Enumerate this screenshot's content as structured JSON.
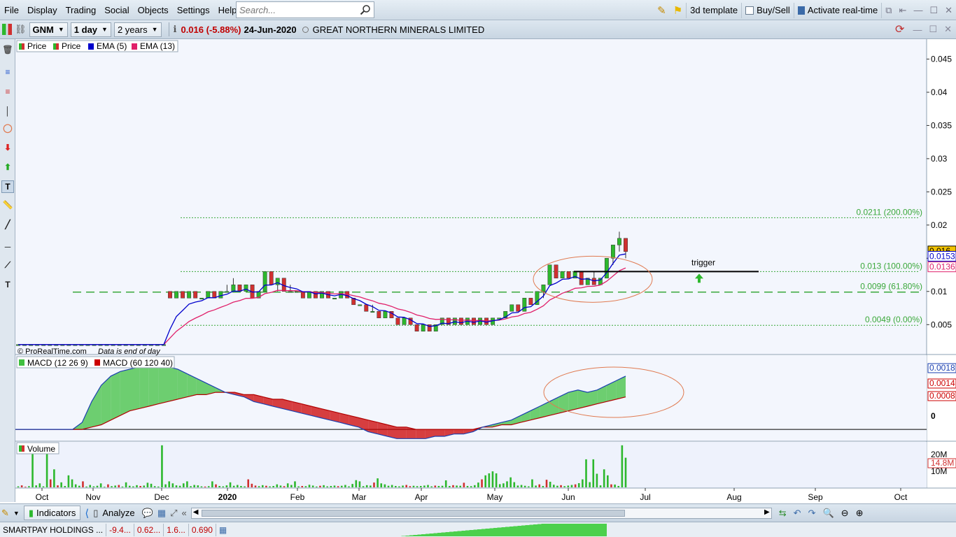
{
  "menu": {
    "items": [
      "File",
      "Display",
      "Trading",
      "Social",
      "Objects",
      "Settings",
      "Help"
    ],
    "search_placeholder": "Search...",
    "template_label": "3d template",
    "buysell_label": "Buy/Sell",
    "realtime_label": "Activate real-time"
  },
  "toolbar": {
    "ticker": "GNM",
    "interval": "1 day",
    "range": "2 years",
    "price_change": "0.016 (-5.88%)",
    "date": "24-Jun-2020",
    "company": "GREAT NORTHERN MINERALS LIMITED"
  },
  "bottom": {
    "indicators_label": "Indicators",
    "analyze_label": "Analyze"
  },
  "status": {
    "ticker": "SMARTPAY HOLDINGS ...",
    "cells": [
      "-9.4...",
      "0.62...",
      "1.6...",
      "0.690"
    ]
  },
  "colors": {
    "ema5": "#0000cc",
    "ema13": "#e0206a",
    "up": "#2db82d",
    "down": "#d03030",
    "fib": "#3aa83a",
    "macd_fill_pos": "#40c040",
    "macd_fill_neg": "#cc0000",
    "ellipse": "#e07a50"
  },
  "chart_data": [
    {
      "type": "candlestick",
      "legend": [
        "Price",
        "Price",
        "EMA (5)",
        "EMA (13)"
      ],
      "watermark": "© ProRealTime.com",
      "watermark_note": "Data is end of day",
      "x_ticks": [
        "Oct",
        "Nov",
        "Dec",
        "2020",
        "Feb",
        "Mar",
        "Apr",
        "May",
        "Jun",
        "Jul",
        "Aug",
        "Sep",
        "Oct"
      ],
      "y_ticks": [
        0.005,
        0.01,
        0.015,
        0.02,
        0.025,
        0.03,
        0.035,
        0.04,
        0.045
      ],
      "ylim": [
        0.0005,
        0.048
      ],
      "last_price": "0.016",
      "ema5_last": "0.0153",
      "ema13_last": "0.0136",
      "fib_levels": [
        {
          "value": 0.0211,
          "label": "0.0211 (200.00%)",
          "style": "dotted"
        },
        {
          "value": 0.013,
          "label": "0.013 (100.00%)",
          "style": "dotted"
        },
        {
          "value": 0.0099,
          "label": "0.0099 (61.80%)",
          "style": "dashed"
        },
        {
          "value": 0.0049,
          "label": "0.0049 (0.00%)",
          "style": "dotted"
        }
      ],
      "annotation": {
        "text": "trigger"
      },
      "ohlc": [
        [
          0.002,
          0.002,
          0.002,
          0.002
        ],
        [
          0.002,
          0.002,
          0.002,
          0.002
        ],
        [
          0.002,
          0.002,
          0.002,
          0.002
        ],
        [
          0.002,
          0.002,
          0.002,
          0.002
        ],
        [
          0.002,
          0.002,
          0.002,
          0.002
        ],
        [
          0.002,
          0.002,
          0.002,
          0.002
        ],
        [
          0.002,
          0.002,
          0.002,
          0.002
        ],
        [
          0.002,
          0.002,
          0.002,
          0.002
        ],
        [
          0.002,
          0.002,
          0.002,
          0.002
        ],
        [
          0.002,
          0.002,
          0.002,
          0.002
        ],
        [
          0.002,
          0.002,
          0.002,
          0.002
        ],
        [
          0.002,
          0.002,
          0.002,
          0.002
        ],
        [
          0.002,
          0.002,
          0.002,
          0.002
        ],
        [
          0.002,
          0.002,
          0.002,
          0.002
        ],
        [
          0.002,
          0.002,
          0.002,
          0.002
        ],
        [
          0.002,
          0.002,
          0.002,
          0.002
        ],
        [
          0.002,
          0.002,
          0.002,
          0.002
        ],
        [
          0.002,
          0.002,
          0.002,
          0.002
        ],
        [
          0.002,
          0.002,
          0.002,
          0.002
        ],
        [
          0.002,
          0.002,
          0.002,
          0.002
        ],
        [
          0.002,
          0.002,
          0.002,
          0.002
        ],
        [
          0.002,
          0.002,
          0.002,
          0.002
        ],
        [
          0.002,
          0.002,
          0.002,
          0.002
        ],
        [
          0.002,
          0.002,
          0.002,
          0.002
        ],
        [
          0.01,
          0.01,
          0.009,
          0.009
        ],
        [
          0.009,
          0.01,
          0.009,
          0.01
        ],
        [
          0.01,
          0.01,
          0.009,
          0.009
        ],
        [
          0.009,
          0.01,
          0.009,
          0.01
        ],
        [
          0.01,
          0.01,
          0.009,
          0.009
        ],
        [
          0.009,
          0.009,
          0.009,
          0.009
        ],
        [
          0.009,
          0.01,
          0.009,
          0.01
        ],
        [
          0.01,
          0.01,
          0.009,
          0.009
        ],
        [
          0.009,
          0.01,
          0.009,
          0.01
        ],
        [
          0.01,
          0.011,
          0.01,
          0.01
        ],
        [
          0.01,
          0.012,
          0.01,
          0.011
        ],
        [
          0.011,
          0.011,
          0.01,
          0.01
        ],
        [
          0.01,
          0.011,
          0.01,
          0.011
        ],
        [
          0.011,
          0.011,
          0.009,
          0.009
        ],
        [
          0.009,
          0.01,
          0.009,
          0.01
        ],
        [
          0.01,
          0.013,
          0.01,
          0.013
        ],
        [
          0.013,
          0.013,
          0.011,
          0.011
        ],
        [
          0.011,
          0.012,
          0.01,
          0.012
        ],
        [
          0.012,
          0.012,
          0.01,
          0.01
        ],
        [
          0.01,
          0.011,
          0.01,
          0.01
        ],
        [
          0.01,
          0.01,
          0.01,
          0.01
        ],
        [
          0.01,
          0.01,
          0.009,
          0.009
        ],
        [
          0.009,
          0.01,
          0.009,
          0.01
        ],
        [
          0.01,
          0.01,
          0.009,
          0.009
        ],
        [
          0.009,
          0.01,
          0.009,
          0.01
        ],
        [
          0.01,
          0.01,
          0.009,
          0.009
        ],
        [
          0.009,
          0.009,
          0.009,
          0.009
        ],
        [
          0.009,
          0.01,
          0.009,
          0.01
        ],
        [
          0.01,
          0.01,
          0.009,
          0.009
        ],
        [
          0.009,
          0.009,
          0.008,
          0.008
        ],
        [
          0.008,
          0.008,
          0.008,
          0.008
        ],
        [
          0.008,
          0.008,
          0.007,
          0.007
        ],
        [
          0.007,
          0.008,
          0.007,
          0.007
        ],
        [
          0.007,
          0.007,
          0.006,
          0.006
        ],
        [
          0.006,
          0.007,
          0.006,
          0.007
        ],
        [
          0.007,
          0.007,
          0.006,
          0.006
        ],
        [
          0.006,
          0.006,
          0.005,
          0.005
        ],
        [
          0.005,
          0.006,
          0.005,
          0.006
        ],
        [
          0.006,
          0.006,
          0.005,
          0.005
        ],
        [
          0.005,
          0.005,
          0.004,
          0.004
        ],
        [
          0.004,
          0.005,
          0.004,
          0.005
        ],
        [
          0.005,
          0.005,
          0.004,
          0.004
        ],
        [
          0.004,
          0.005,
          0.004,
          0.005
        ],
        [
          0.005,
          0.006,
          0.005,
          0.006
        ],
        [
          0.006,
          0.006,
          0.005,
          0.005
        ],
        [
          0.005,
          0.006,
          0.005,
          0.006
        ],
        [
          0.006,
          0.006,
          0.005,
          0.005
        ],
        [
          0.005,
          0.006,
          0.005,
          0.006
        ],
        [
          0.006,
          0.006,
          0.005,
          0.005
        ],
        [
          0.005,
          0.006,
          0.005,
          0.006
        ],
        [
          0.006,
          0.006,
          0.005,
          0.005
        ],
        [
          0.005,
          0.006,
          0.005,
          0.006
        ],
        [
          0.006,
          0.006,
          0.006,
          0.006
        ],
        [
          0.006,
          0.007,
          0.006,
          0.007
        ],
        [
          0.007,
          0.008,
          0.007,
          0.008
        ],
        [
          0.008,
          0.008,
          0.007,
          0.007
        ],
        [
          0.007,
          0.009,
          0.007,
          0.009
        ],
        [
          0.009,
          0.009,
          0.008,
          0.008
        ],
        [
          0.008,
          0.01,
          0.008,
          0.01
        ],
        [
          0.01,
          0.011,
          0.009,
          0.011
        ],
        [
          0.011,
          0.014,
          0.011,
          0.014
        ],
        [
          0.014,
          0.014,
          0.012,
          0.012
        ],
        [
          0.012,
          0.013,
          0.012,
          0.013
        ],
        [
          0.013,
          0.013,
          0.012,
          0.012
        ],
        [
          0.012,
          0.013,
          0.012,
          0.013
        ],
        [
          0.013,
          0.013,
          0.011,
          0.011
        ],
        [
          0.011,
          0.012,
          0.011,
          0.012
        ],
        [
          0.012,
          0.013,
          0.011,
          0.011
        ],
        [
          0.011,
          0.012,
          0.011,
          0.012
        ],
        [
          0.012,
          0.015,
          0.012,
          0.015
        ],
        [
          0.015,
          0.017,
          0.014,
          0.017
        ],
        [
          0.017,
          0.019,
          0.016,
          0.018
        ],
        [
          0.018,
          0.018,
          0.015,
          0.016
        ]
      ]
    },
    {
      "type": "area",
      "legend": [
        "MACD (12 26 9)",
        "MACD (60 120 40)"
      ],
      "axis_labels": [
        "0.0018",
        "0.0014",
        "0.0008",
        "0"
      ],
      "zero_value": 0,
      "macd_fast": [
        0,
        0,
        0,
        0,
        0,
        0,
        0,
        0.0003,
        0.0012,
        0.0019,
        0.0023,
        0.0025,
        0.0026,
        0.0027,
        0.0028,
        0.0028,
        0.0027,
        0.0026,
        0.0024,
        0.0022,
        0.002,
        0.0018,
        0.0016,
        0.0015,
        0.0014,
        0.0012,
        0.0011,
        0.001,
        0.0009,
        0.0008,
        0.0007,
        0.0006,
        0.0005,
        0.0004,
        0.0003,
        0.0002,
        0.0001,
        -0.0001,
        -0.0002,
        -0.0003,
        -0.0004,
        -0.0004,
        -0.0004,
        -0.0004,
        -0.0003,
        -0.0003,
        -0.0002,
        -0.0002,
        -0.0001,
        0.0001,
        0.0002,
        0.0003,
        0.0004,
        0.0006,
        0.0008,
        0.001,
        0.0012,
        0.0014,
        0.0016,
        0.0017,
        0.0016,
        0.0017,
        0.0019,
        0.0021,
        0.0023
      ],
      "macd_slow": [
        0,
        0,
        0,
        0,
        0,
        0,
        0,
        0,
        0.0001,
        0.0002,
        0.0004,
        0.0006,
        0.0008,
        0.0009,
        0.001,
        0.0011,
        0.0012,
        0.0013,
        0.0014,
        0.0015,
        0.0015,
        0.0016,
        0.0016,
        0.0016,
        0.0015,
        0.0015,
        0.0014,
        0.0013,
        0.0013,
        0.0012,
        0.0011,
        0.001,
        0.0009,
        0.0008,
        0.0007,
        0.0006,
        0.0005,
        0.0004,
        0.0003,
        0.0002,
        0.0001,
        0.0001,
        0,
        0,
        0,
        0,
        0,
        0,
        0,
        0.0001,
        0.0001,
        0.0002,
        0.0002,
        0.0003,
        0.0004,
        0.0005,
        0.0006,
        0.0007,
        0.0008,
        0.0009,
        0.001,
        0.0011,
        0.0012,
        0.0013,
        0.0014
      ]
    },
    {
      "type": "bar",
      "legend": [
        "Volume"
      ],
      "axis_labels": [
        "20M",
        "14.8M",
        "10M"
      ],
      "ylim": [
        0,
        22
      ],
      "unit": "M",
      "volumes": [
        0.5,
        1,
        0.3,
        0.6,
        20,
        1,
        2,
        0.5,
        20,
        4,
        9,
        1,
        2.5,
        0.7,
        6,
        4,
        1.5,
        0.8,
        3,
        0.4,
        1.2,
        0.5,
        0.8,
        2,
        0.3,
        1.5,
        0.6,
        0.9,
        1.2,
        0.4,
        2.5,
        0.8,
        0.5,
        1.1,
        0.7,
        0.9,
        2.3,
        1.8,
        0.6,
        0.4,
        21,
        1.5,
        3,
        2,
        1,
        0.8,
        2,
        3,
        0.6,
        1.2,
        1,
        0.5,
        0.4,
        0.6,
        3,
        1.5,
        0.7,
        0.5,
        1,
        2.5,
        0.8,
        1.2,
        0.7,
        0.5,
        4,
        1.8,
        0.9,
        0.6,
        1.1,
        0.8,
        0.5,
        0.7,
        1.5,
        0.9,
        0.6,
        2,
        1.2,
        3,
        0.5,
        0.7,
        0.6,
        1.3,
        0.9,
        0.4,
        0.8,
        1.1,
        0.5,
        0.7,
        0.9,
        0.6,
        0.8,
        1.2,
        0.5,
        1.7,
        3.6,
        3,
        0.6,
        1.1,
        0.9,
        2.4,
        4.5,
        2,
        1.5,
        0.8,
        1.2,
        0.7,
        0.5,
        0.9,
        1.2,
        0.6,
        0.8,
        0.6,
        0.7,
        0.9,
        1.2,
        0.5,
        0.9,
        0.7,
        0.8,
        3.5,
        0.7,
        1.1,
        0.9,
        0.8,
        2.3,
        0.7,
        0.6,
        1.1,
        2.4,
        4,
        6,
        7,
        8,
        7,
        1.6,
        2,
        3,
        5,
        2.6,
        0.9,
        1.2,
        0.8,
        0.5,
        4,
        0.9,
        1.5,
        0.7,
        3.8,
        2.8,
        1.3,
        0.8,
        1.1,
        0.6,
        0.9,
        1.2,
        1.5,
        2.1,
        4,
        14,
        2.6,
        14,
        6.8,
        1,
        9,
        6,
        1.5,
        1.4,
        0.7,
        21,
        14.8
      ]
    }
  ]
}
